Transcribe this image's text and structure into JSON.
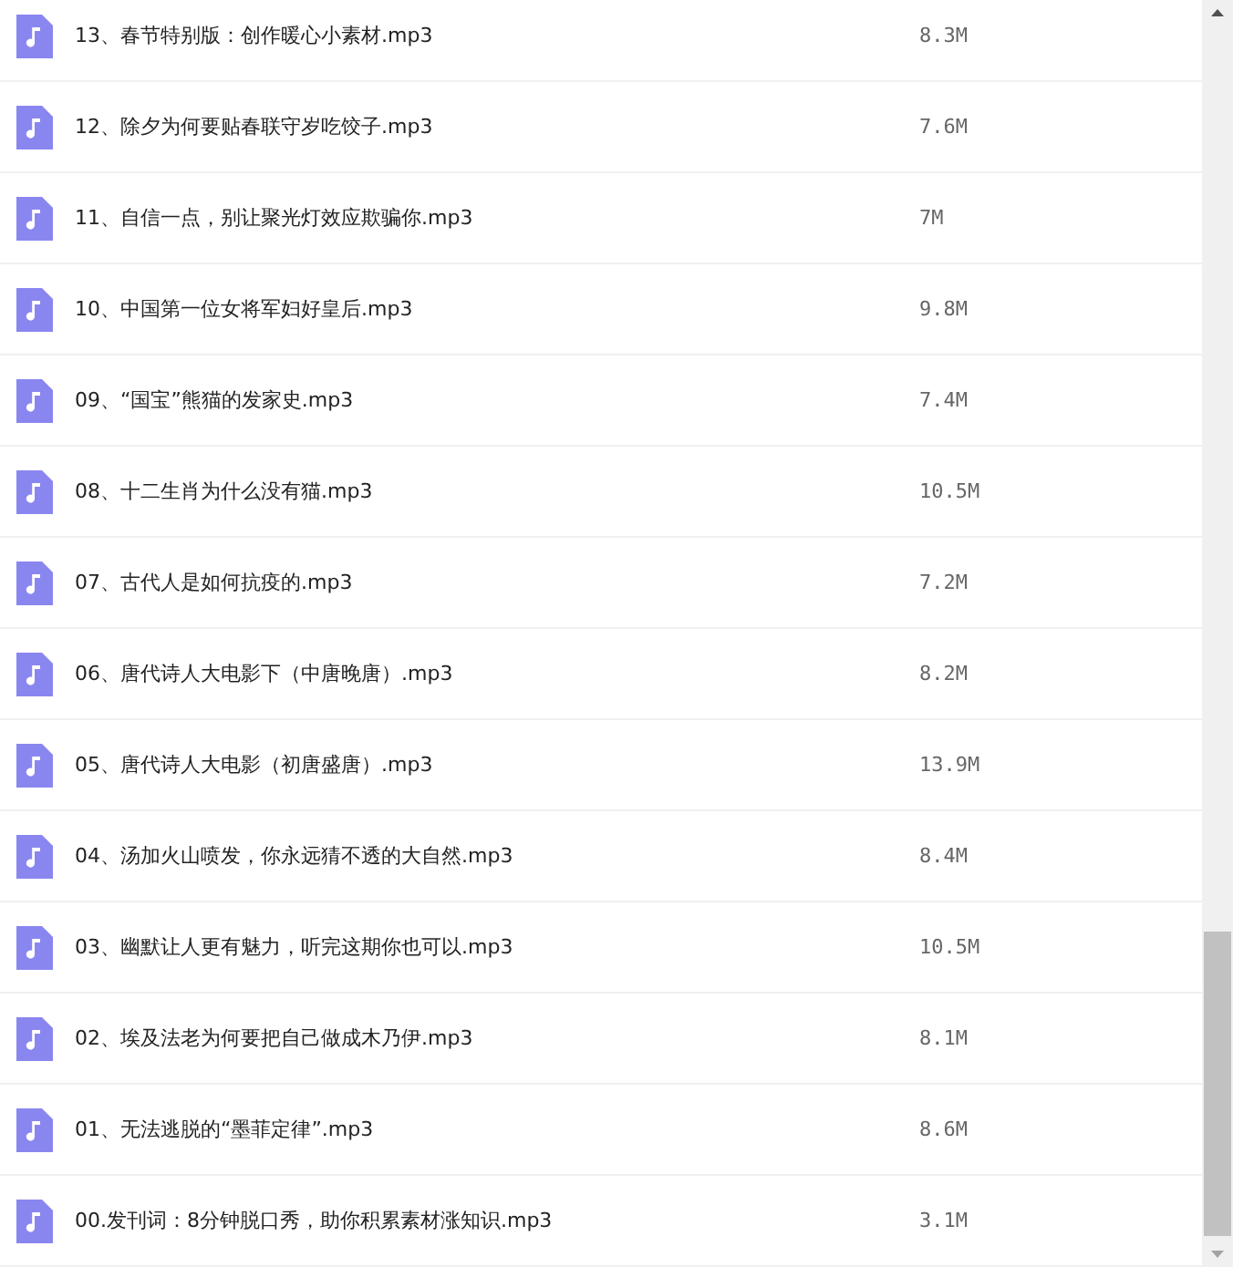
{
  "files": [
    {
      "name": "13、春节特别版：创作暖心小素材.mp3",
      "size": "8.3M"
    },
    {
      "name": "12、除夕为何要贴春联守岁吃饺子.mp3",
      "size": "7.6M"
    },
    {
      "name": "11、自信一点，别让聚光灯效应欺骗你.mp3",
      "size": "7M"
    },
    {
      "name": "10、中国第一位女将军妇好皇后.mp3",
      "size": "9.8M"
    },
    {
      "name": "09、“国宝”熊猫的发家史.mp3",
      "size": "7.4M"
    },
    {
      "name": "08、十二生肖为什么没有猫.mp3",
      "size": "10.5M"
    },
    {
      "name": "07、古代人是如何抗疫的.mp3",
      "size": "7.2M"
    },
    {
      "name": "06、唐代诗人大电影下（中唐晚唐）.mp3",
      "size": "8.2M"
    },
    {
      "name": "05、唐代诗人大电影（初唐盛唐）.mp3",
      "size": "13.9M"
    },
    {
      "name": "04、汤加火山喷发，你永远猜不透的大自然.mp3",
      "size": "8.4M"
    },
    {
      "name": "03、幽默让人更有魅力，听完这期你也可以.mp3",
      "size": "10.5M"
    },
    {
      "name": "02、埃及法老为何要把自己做成木乃伊.mp3",
      "size": "8.1M"
    },
    {
      "name": "01、无法逃脱的“墨菲定律”.mp3",
      "size": "8.6M"
    },
    {
      "name": "00.发刊词：8分钟脱口秀，助你积累素材涨知识.mp3",
      "size": "3.1M"
    }
  ]
}
